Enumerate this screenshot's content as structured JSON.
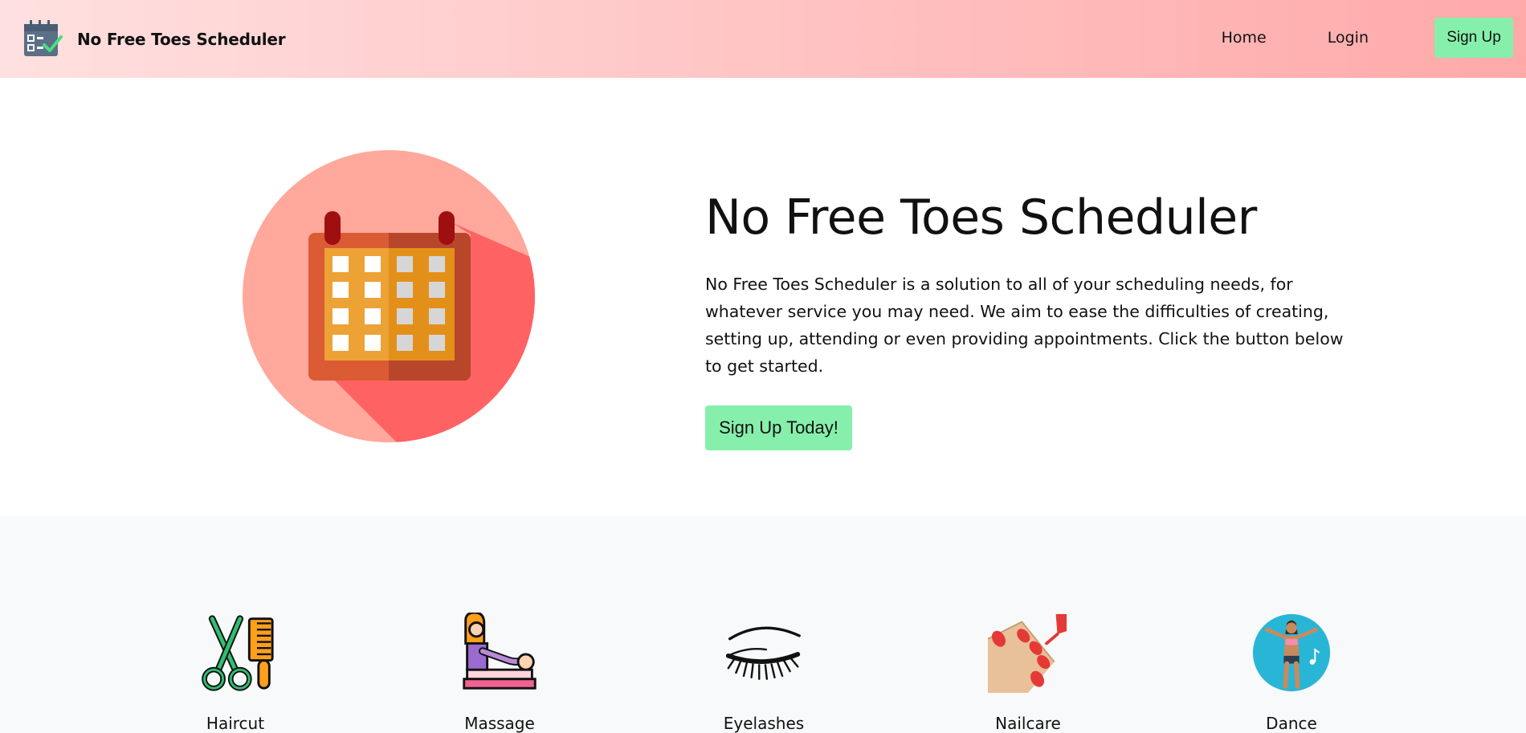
{
  "nav": {
    "brand": "No Free Toes Scheduler",
    "links": {
      "home": "Home",
      "login": "Login"
    },
    "signup": "Sign Up"
  },
  "hero": {
    "title": "No Free Toes Scheduler",
    "description": "No Free Toes Scheduler is a solution to all of your scheduling needs, for whatever service you may need. We aim to ease the difficulties of creating, setting up, attending or even providing appointments. Click the button below to get started.",
    "cta": "Sign Up Today!"
  },
  "services": [
    {
      "label": "Haircut",
      "icon": "scissors-comb-icon"
    },
    {
      "label": "Massage",
      "icon": "massage-icon"
    },
    {
      "label": "Eyelashes",
      "icon": "eyelash-icon"
    },
    {
      "label": "Nailcare",
      "icon": "nail-polish-icon"
    },
    {
      "label": "Dance",
      "icon": "dancer-icon"
    }
  ],
  "colors": {
    "accent": "#86efac",
    "header_start": "#ffe0e0",
    "header_end": "#ffa9a9",
    "section_bg": "#f8f9fa"
  }
}
